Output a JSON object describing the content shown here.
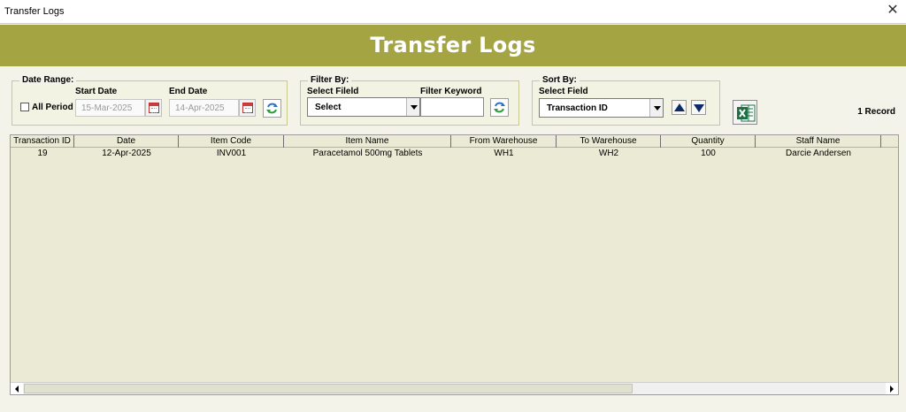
{
  "window": {
    "title": "Transfer Logs",
    "close_glyph": "✕"
  },
  "banner": {
    "title": "Transfer Logs"
  },
  "date_range": {
    "legend": "Date Range:",
    "all_period_label": "All Period",
    "all_period_checked": false,
    "start_label": "Start Date",
    "start_value": "15-Mar-2025",
    "end_label": "End Date",
    "end_value": "14-Apr-2025"
  },
  "filter": {
    "legend": "Filter By:",
    "field_label": "Select Fileld",
    "field_value": "Select",
    "keyword_label": "Filter Keyword",
    "keyword_value": ""
  },
  "sort": {
    "legend": "Sort By:",
    "field_label": "Select Field",
    "field_value": "Transaction ID"
  },
  "record_count": "1 Record",
  "table": {
    "columns": [
      "Transaction ID",
      "Date",
      "Item Code",
      "Item Name",
      "From Warehouse",
      "To Warehouse",
      "Quantity",
      "Staff Name"
    ],
    "rows": [
      [
        "19",
        "12-Apr-2025",
        "INV001",
        "Paracetamol 500mg Tablets",
        "WH1",
        "WH2",
        "100",
        "Darcie Andersen"
      ]
    ]
  },
  "colors": {
    "banner": "#a4a443",
    "grid_bg": "#eaead5",
    "sort_arrow": "#0c2a66",
    "excel_green": "#1d7044"
  },
  "icons": [
    "close-icon",
    "calendar-icon",
    "refresh-icon",
    "dropdown-arrow-icon",
    "sort-ascending-icon",
    "sort-descending-icon",
    "excel-icon",
    "scroll-left-icon",
    "scroll-right-icon"
  ]
}
